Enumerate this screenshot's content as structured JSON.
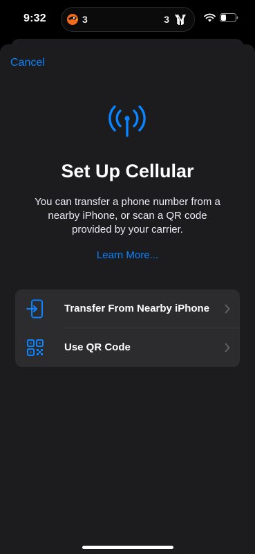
{
  "status_bar": {
    "time": "9:32",
    "live_activity": {
      "away_score": "3",
      "home_score": "3",
      "away_team_icon": "orioles-bird-icon",
      "home_team_icon": "yankees-logo-icon"
    },
    "icons": [
      "wifi-icon",
      "battery-icon"
    ]
  },
  "nav": {
    "cancel_label": "Cancel"
  },
  "hero": {
    "icon": "cellular-antenna-icon",
    "title": "Set Up Cellular",
    "description": "You can transfer a phone number from a nearby iPhone, or scan a QR code provided by your carrier.",
    "learn_more": "Learn More..."
  },
  "options": [
    {
      "label": "Transfer From Nearby iPhone",
      "icon": "transfer-phone-icon"
    },
    {
      "label": "Use QR Code",
      "icon": "qr-code-icon"
    }
  ],
  "colors": {
    "accent": "#0a84ff",
    "sheet": "#1c1c1e",
    "card": "#2c2c2e",
    "background": "#000000"
  }
}
